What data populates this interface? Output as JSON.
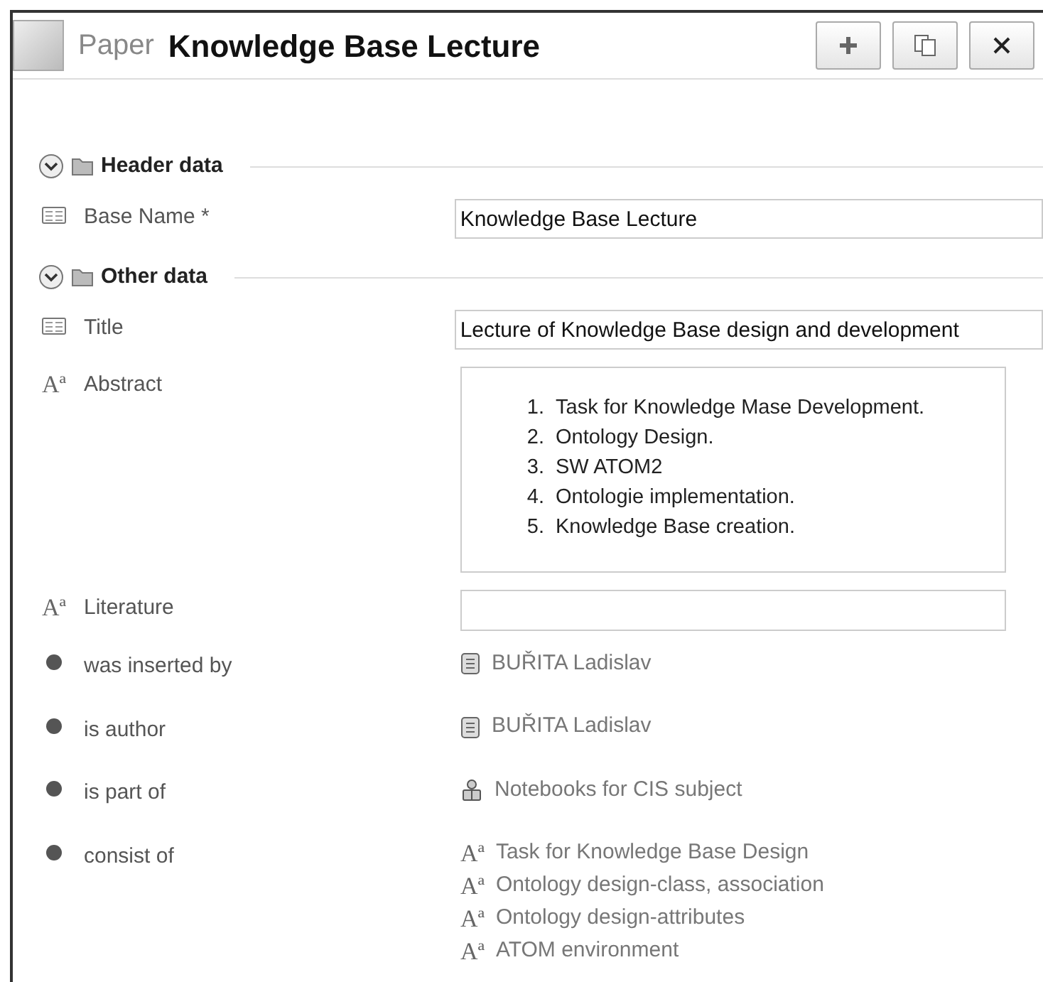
{
  "header": {
    "type_label": "Paper",
    "title": "Knowledge Base Lecture"
  },
  "sections": [
    {
      "title": "Header data",
      "expanded": true,
      "rows": [
        {
          "label": "Base Name *",
          "kind": "input",
          "value": "Knowledge Base Lecture"
        }
      ]
    },
    {
      "title": "Other data",
      "expanded": true,
      "rows": [
        {
          "label": "Title",
          "kind": "input",
          "value": "Lecture of Knowledge Base design and development"
        },
        {
          "label": "Abstract",
          "glyph": "Aª",
          "kind": "list",
          "items": [
            {
              "number": "1.",
              "text": "Task for Knowledge Mase Development."
            },
            {
              "number": "2.",
              "text": "Ontology Design."
            },
            {
              "number": "3.",
              "text": "SW ATOM2"
            },
            {
              "number": "4.",
              "text": "Ontologie implementation."
            },
            {
              "number": "5.",
              "text": "Knowledge Base creation."
            }
          ]
        },
        {
          "label": "Literature",
          "glyph": "Aª",
          "kind": "empty"
        },
        {
          "label": "was inserted by",
          "kind": "links",
          "links": [
            {
              "kind": "person",
              "text": "BUŘITA Ladislav"
            }
          ]
        },
        {
          "label": "is author",
          "kind": "links",
          "links": [
            {
              "kind": "person",
              "text": "BUŘITA Ladislav"
            }
          ]
        },
        {
          "label": "is part of",
          "kind": "links",
          "links": [
            {
              "kind": "group",
              "text": "Notebooks for CIS subject"
            }
          ]
        },
        {
          "label": "consist of",
          "kind": "links",
          "links": [
            {
              "kind": "text",
              "glyph": "Aª",
              "text": "Task for Knowledge Base Design"
            },
            {
              "kind": "text",
              "glyph": "Aª",
              "text": "Ontology design-class, association"
            },
            {
              "kind": "text",
              "glyph": "Aª",
              "text": "Ontology design-attributes"
            },
            {
              "kind": "text",
              "glyph": "Aª",
              "text": "ATOM environment"
            }
          ]
        }
      ]
    }
  ]
}
